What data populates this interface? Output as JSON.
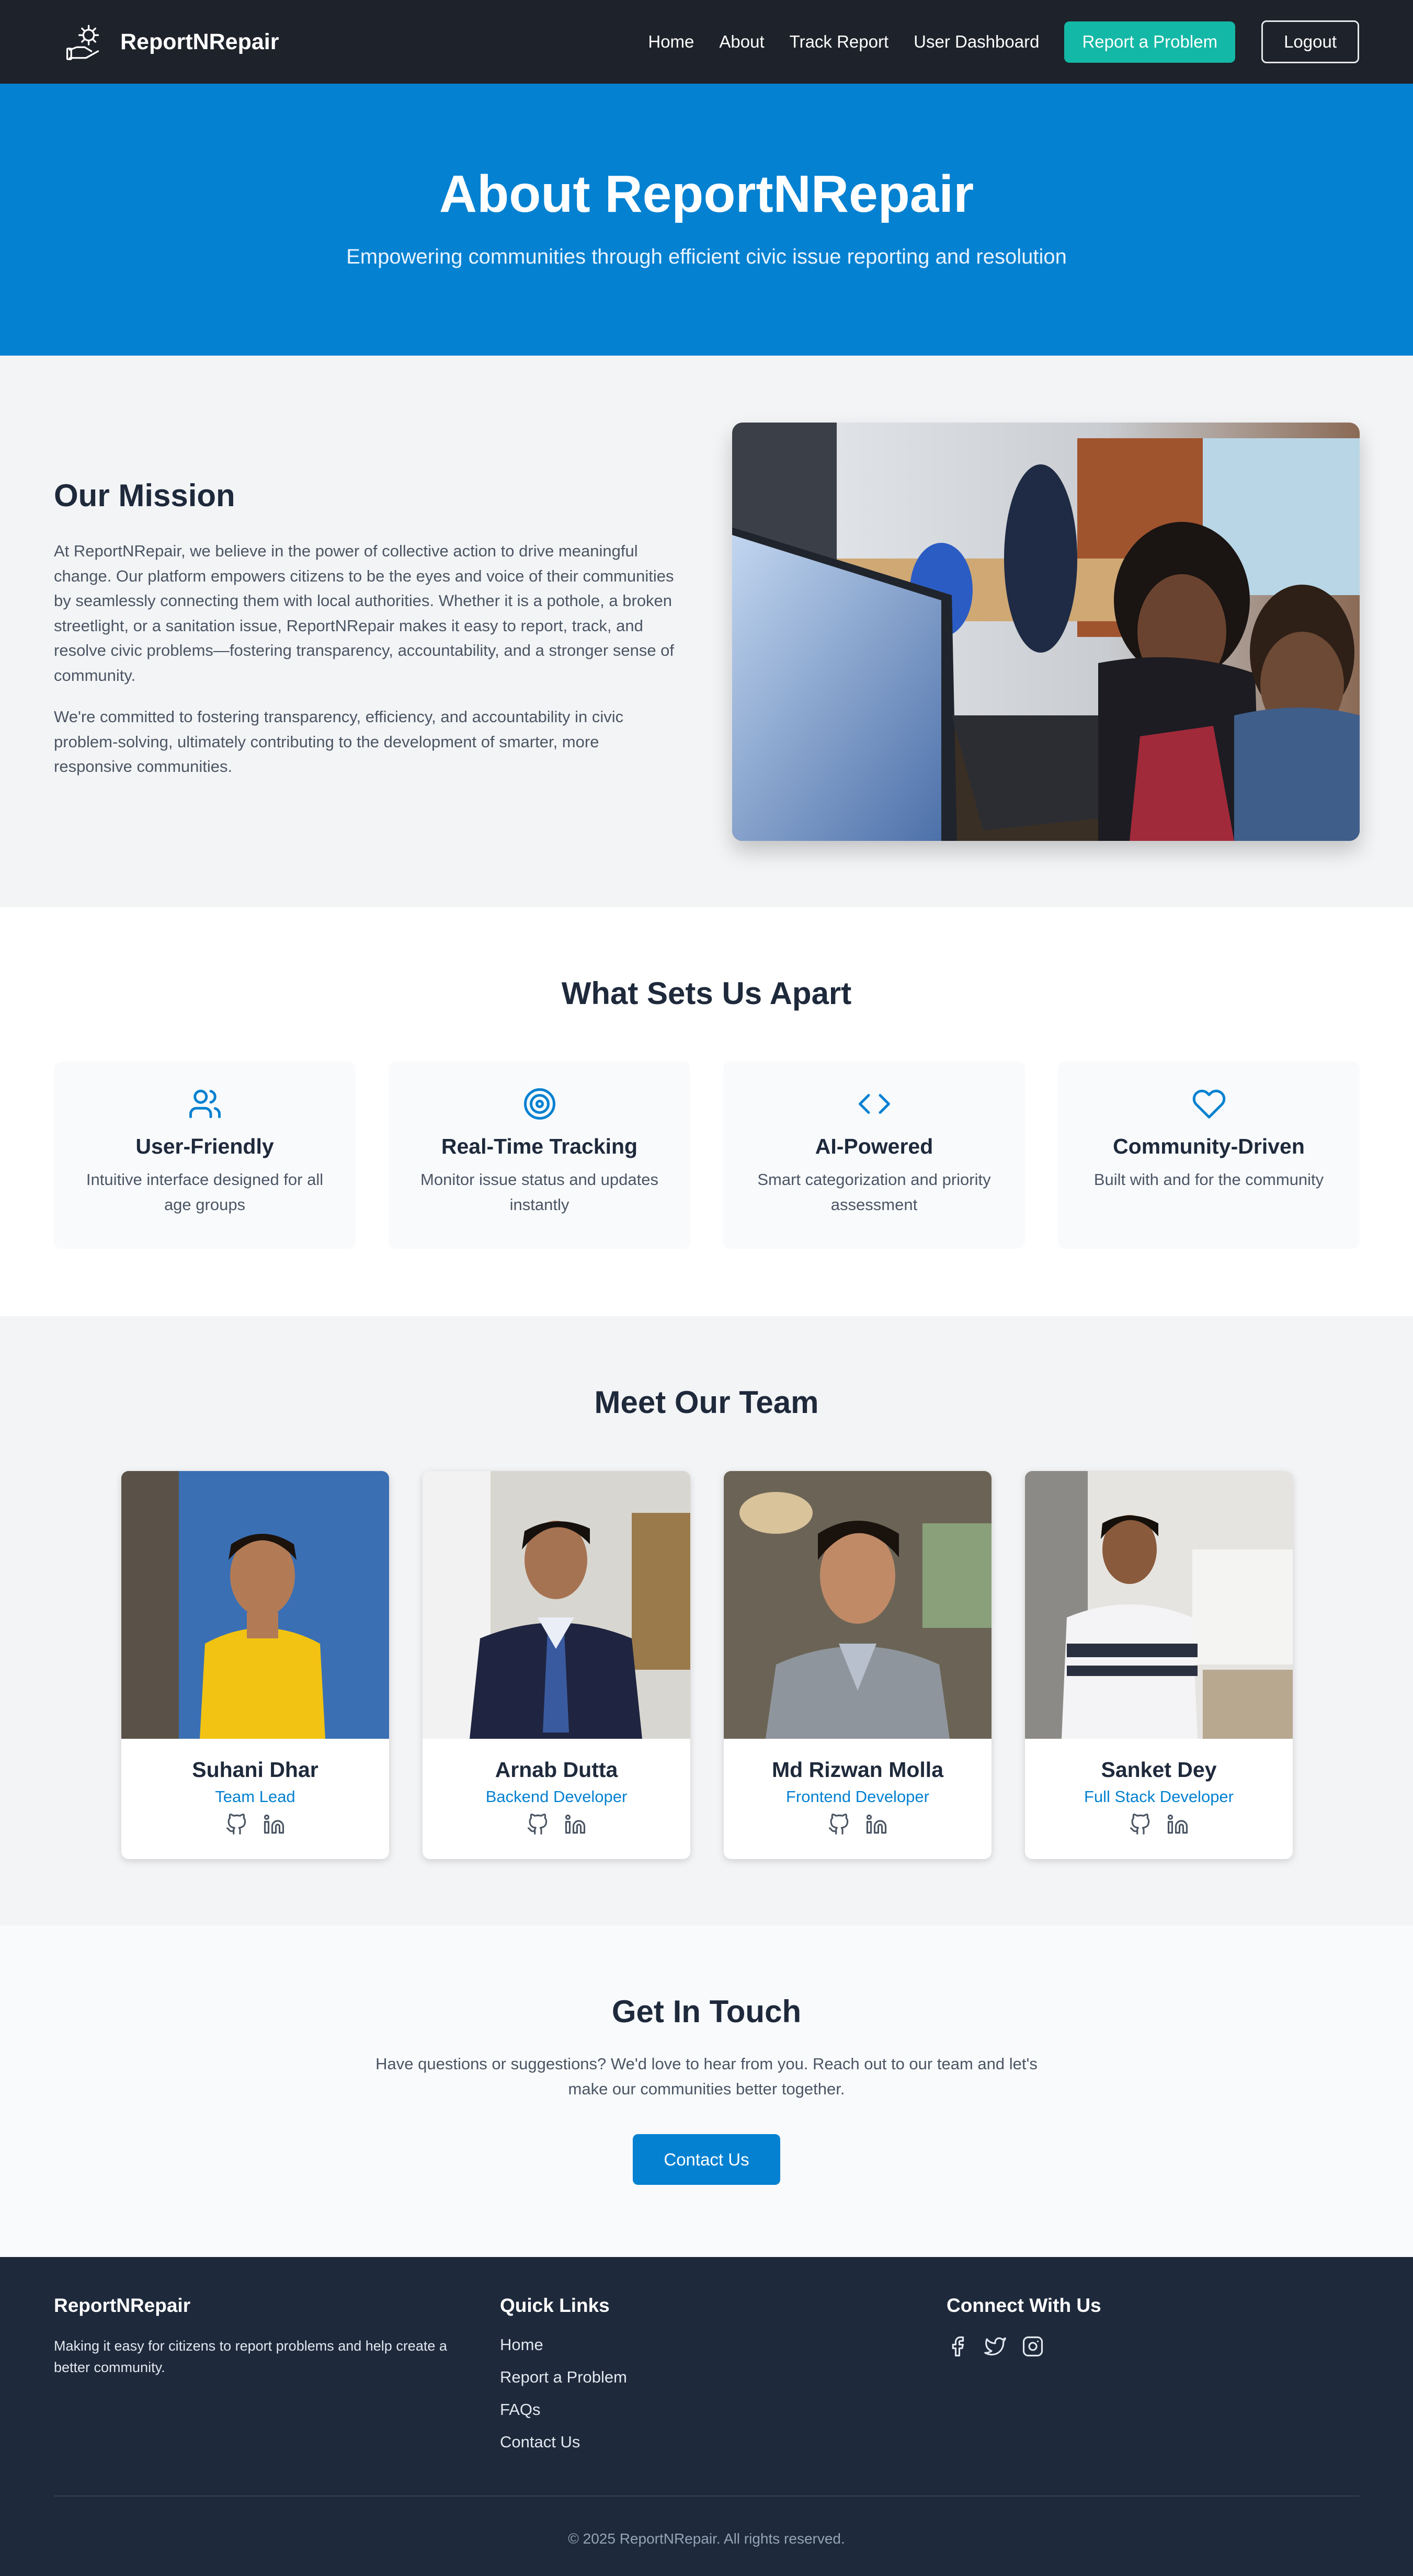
{
  "nav": {
    "brand": "ReportNRepair",
    "links": [
      "Home",
      "About",
      "Track Report",
      "User Dashboard"
    ],
    "report_button": "Report a Problem",
    "logout_button": "Logout"
  },
  "hero": {
    "title": "About ReportNRepair",
    "subtitle": "Empowering communities through efficient civic issue reporting and resolution"
  },
  "mission": {
    "title": "Our Mission",
    "paragraphs": [
      "At ReportNRepair, we believe in the power of collective action to drive meaningful change. Our platform empowers citizens to be the eyes and voice of their communities by seamlessly connecting them with local authorities. Whether it is a pothole, a broken streetlight, or a sanitation issue, ReportNRepair makes it easy to report, track, and resolve civic problems—fostering transparency, accountability, and a stronger sense of community.",
      "We're committed to fostering transparency, efficiency, and accountability in civic problem-solving, ultimately contributing to the development of smarter, more responsive communities."
    ]
  },
  "features": {
    "title": "What Sets Us Apart",
    "items": [
      {
        "icon": "users-icon",
        "title": "User-Friendly",
        "description": "Intuitive interface designed for all age groups"
      },
      {
        "icon": "target-icon",
        "title": "Real-Time Tracking",
        "description": "Monitor issue status and updates instantly"
      },
      {
        "icon": "code-icon",
        "title": "AI-Powered",
        "description": "Smart categorization and priority assessment"
      },
      {
        "icon": "heart-icon",
        "title": "Community-Driven",
        "description": "Built with and for the community"
      }
    ]
  },
  "team": {
    "title": "Meet Our Team",
    "members": [
      {
        "name": "Suhani Dhar",
        "role": "Team Lead"
      },
      {
        "name": "Arnab Dutta",
        "role": "Backend Developer"
      },
      {
        "name": "Md Rizwan Molla",
        "role": "Frontend Developer"
      },
      {
        "name": "Sanket Dey",
        "role": "Full Stack Developer"
      }
    ]
  },
  "contact": {
    "title": "Get In Touch",
    "text": "Have questions or suggestions? We'd love to hear from you. Reach out to our team and let's make our communities better together.",
    "button": "Contact Us"
  },
  "footer": {
    "brand": "ReportNRepair",
    "description": "Making it easy for citizens to report problems and help create a better community.",
    "quick_links_title": "Quick Links",
    "quick_links": [
      "Home",
      "Report a Problem",
      "FAQs",
      "Contact Us"
    ],
    "connect_title": "Connect With Us",
    "copyright": "© 2025 ReportNRepair. All rights reserved."
  },
  "colors": {
    "primary": "#0481d1",
    "accent": "#14b8a6",
    "dark": "#1e222a",
    "footer": "#1e293b"
  }
}
